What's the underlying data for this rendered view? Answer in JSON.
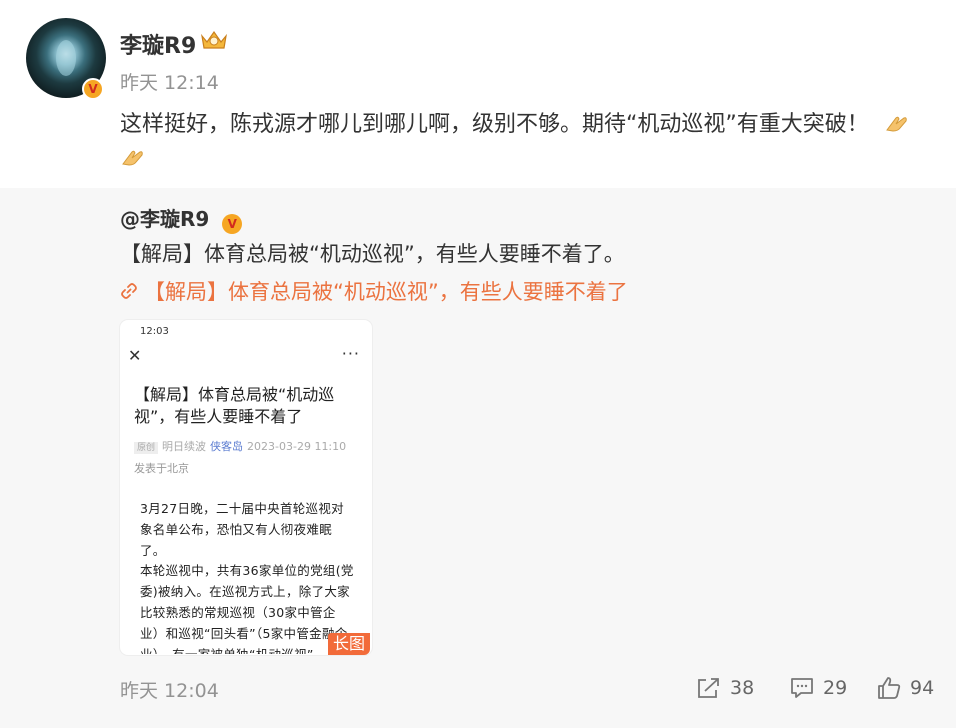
{
  "post": {
    "username": "李璇R9",
    "time": "昨天 12:14",
    "text": "这样挺好，陈戎源才哪儿到哪儿啊，级别不够。期待“机动巡视”有重大突破！"
  },
  "repost": {
    "username": "@李璇R9",
    "text": "【解局】体育总局被“机动巡视”，有些人要睡不着了。",
    "link_text": "【解局】体育总局被“机动巡视”，有些人要睡不着了",
    "image": {
      "status_time": "12:03",
      "title": "【解局】体育总局被“机动巡视”，有些人要睡不着了",
      "tag": "原创",
      "author": "明日续波",
      "source": "侠客岛",
      "date": "2023-03-29 11:10",
      "location": "发表于北京",
      "para1": "3月27日晚，二十届中央首轮巡视对象名单公布，恐怕又有人彻夜难眠了。",
      "para2": "本轮巡视中，共有36家单位的党组(党委)被纳入。在巡视方式上，除了大家比较熟悉的常规巡视（30家中管企业）和巡视“回头看”（5家中管金融企业），有一家被单独“机动巡视”",
      "long_label": "长图"
    },
    "time": "昨天 12:04",
    "actions": {
      "share": "38",
      "comment": "29",
      "like": "94"
    }
  },
  "icons": [
    "verified-icon",
    "crown-icon",
    "folded-hands-icon",
    "link-icon",
    "close-icon",
    "more-icon",
    "share-icon",
    "comment-icon",
    "like-icon"
  ],
  "colors": {
    "link": "#eb7340",
    "badge": "#f6a623",
    "long_tag": "#f26b3a",
    "muted": "#939393"
  }
}
